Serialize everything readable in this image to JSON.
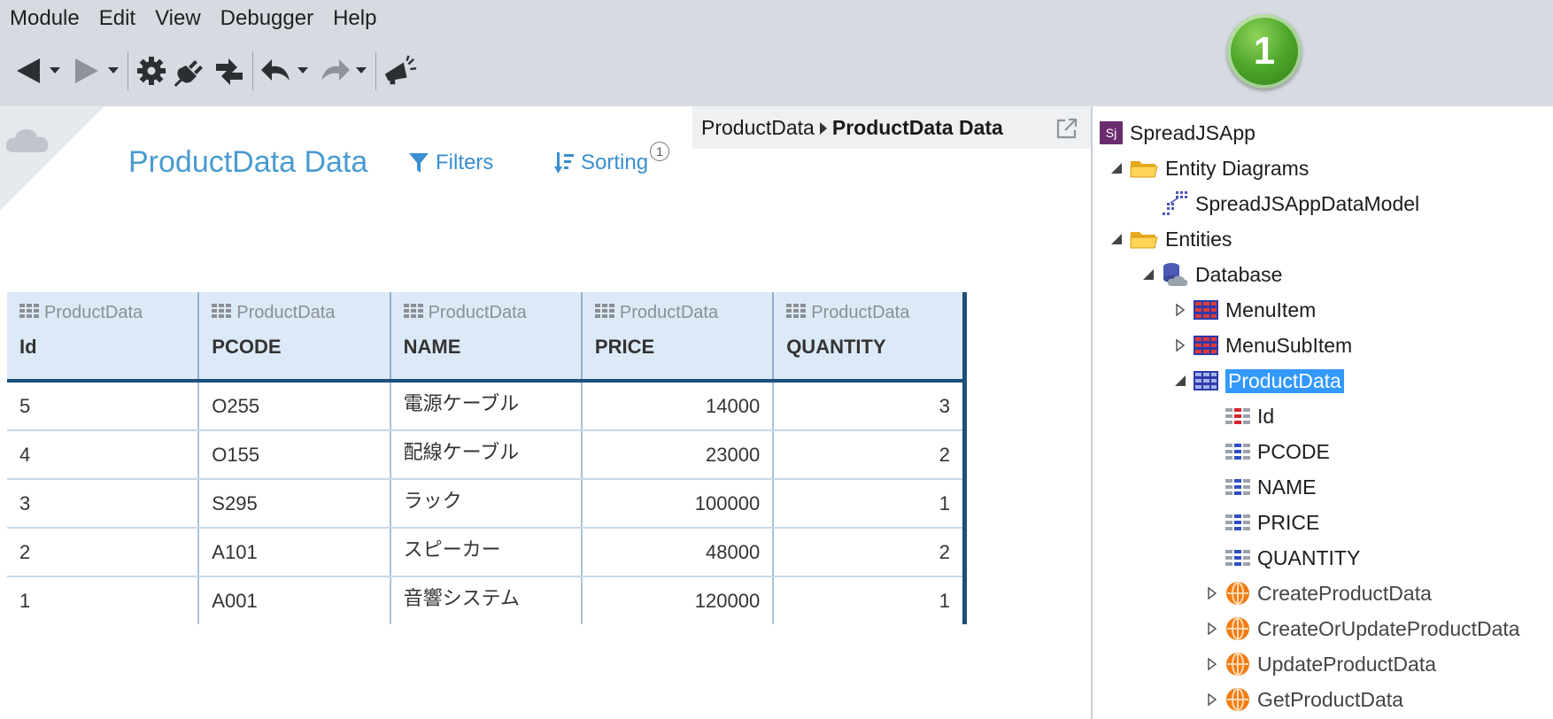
{
  "menu": [
    "Module",
    "Edit",
    "View",
    "Debugger",
    "Help"
  ],
  "toolbar": {
    "icons": [
      "back-arrow-icon",
      "forward-arrow-icon",
      "gear-icon",
      "plug-icon",
      "publish-icon",
      "undo-icon",
      "redo-icon",
      "megaphone-icon"
    ]
  },
  "badge": {
    "value": "1",
    "color": "#4ea82a"
  },
  "breadcrumb": {
    "parent": "ProductData",
    "current": "ProductData Data"
  },
  "screen": {
    "title": "ProductData Data",
    "filters_label": "Filters",
    "sorting_label": "Sorting",
    "sorting_count": "1"
  },
  "table": {
    "columns": [
      {
        "entity": "ProductData",
        "attribute": "Id"
      },
      {
        "entity": "ProductData",
        "attribute": "PCODE"
      },
      {
        "entity": "ProductData",
        "attribute": "NAME"
      },
      {
        "entity": "ProductData",
        "attribute": "PRICE"
      },
      {
        "entity": "ProductData",
        "attribute": "QUANTITY"
      }
    ],
    "rows": [
      [
        "5",
        "O255",
        "電源ケーブル",
        "14000",
        "3"
      ],
      [
        "4",
        "O155",
        "配線ケーブル",
        "23000",
        "2"
      ],
      [
        "3",
        "S295",
        "ラック",
        "100000",
        "1"
      ],
      [
        "2",
        "A101",
        "スピーカー",
        "48000",
        "2"
      ],
      [
        "1",
        "A001",
        "音響システム",
        "120000",
        "1"
      ]
    ]
  },
  "tree": {
    "app": {
      "label": "SpreadJSApp",
      "icon_text": "Sj",
      "icon_color": "#6b2c6e"
    },
    "entity_diagrams": {
      "label": "Entity Diagrams",
      "children": [
        "SpreadJSAppDataModel"
      ]
    },
    "entities": {
      "label": "Entities",
      "database": {
        "label": "Database",
        "items": [
          "MenuItem",
          "MenuSubItem",
          "ProductData"
        ],
        "selected": "ProductData",
        "attributes": [
          "Id",
          "PCODE",
          "NAME",
          "PRICE",
          "QUANTITY"
        ],
        "actions": [
          "CreateProductData",
          "CreateOrUpdateProductData",
          "UpdateProductData",
          "GetProductData"
        ]
      }
    }
  },
  "colors": {
    "accent": "#3a8fd0",
    "selection": "#3399ff",
    "header_bg": "#dceaf7",
    "chrome": "#d5dbe1"
  }
}
